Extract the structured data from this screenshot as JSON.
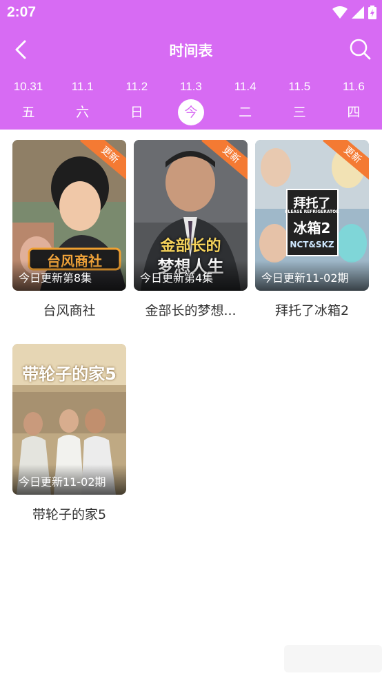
{
  "status": {
    "time": "2:07"
  },
  "header": {
    "title": "时间表"
  },
  "dates": [
    {
      "date": "10.31",
      "weekday": "五",
      "selected": false
    },
    {
      "date": "11.1",
      "weekday": "六",
      "selected": false
    },
    {
      "date": "11.2",
      "weekday": "日",
      "selected": false
    },
    {
      "date": "11.3",
      "weekday": "今",
      "selected": true
    },
    {
      "date": "11.4",
      "weekday": "二",
      "selected": false
    },
    {
      "date": "11.5",
      "weekday": "三",
      "selected": false
    },
    {
      "date": "11.6",
      "weekday": "四",
      "selected": false
    }
  ],
  "shows": [
    {
      "title": "台风商社",
      "update": "今日更新第8集",
      "badge": "更新",
      "poster_text": "台风商社"
    },
    {
      "title": "金部长的梦想...",
      "update": "今日更新第4集",
      "badge": "更新",
      "poster_text_1": "金部长的",
      "poster_text_2": "梦想人生"
    },
    {
      "title": "拜托了冰箱2",
      "update": "今日更新11-02期",
      "badge": "更新",
      "poster_text_1": "拜托了",
      "poster_text_sub": "PLEASE REFRIGERATOR",
      "poster_text_2": "冰箱2",
      "poster_text_3": "NCT&SKZ"
    },
    {
      "title": "带轮子的家5",
      "update": "今日更新11-02期",
      "poster_text": "带轮子的家5"
    }
  ],
  "colors": {
    "accent": "#d76bf3",
    "badge": "#f47a33"
  }
}
